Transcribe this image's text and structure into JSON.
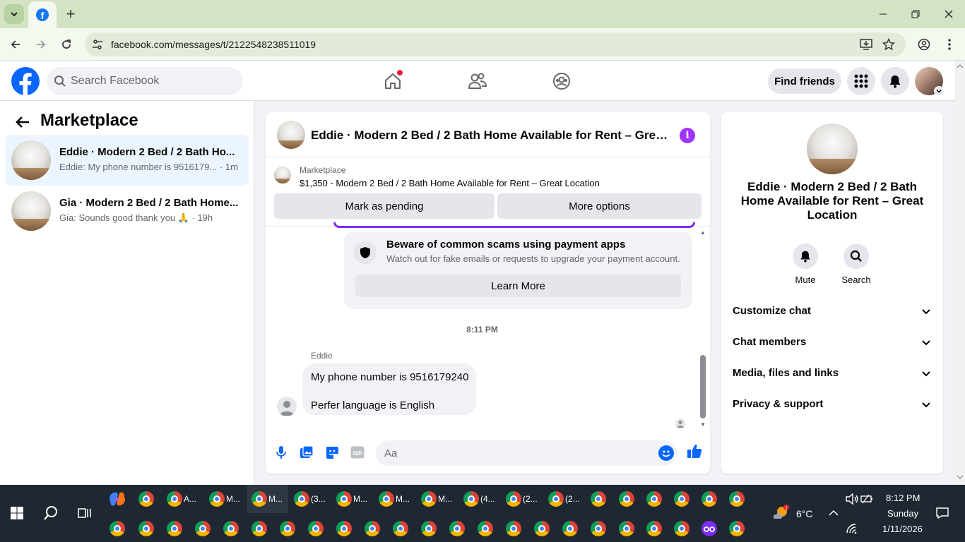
{
  "browser": {
    "url": "facebook.com/messages/t/2122548238511019"
  },
  "header": {
    "search_placeholder": "Search Facebook",
    "find_friends_label": "Find friends"
  },
  "left_panel": {
    "title": "Marketplace",
    "conversations": [
      {
        "title": "Eddie · Modern 2 Bed / 2 Bath Ho...",
        "preview": "Eddie: My phone number is 9516179...",
        "time": "· 1m",
        "active": true
      },
      {
        "title": "Gia · Modern 2 Bed / 2 Bath Home...",
        "preview": "Gia: Sounds good thank you 🙏",
        "time": "· 19h",
        "active": false
      }
    ]
  },
  "chat": {
    "title": "Eddie · Modern 2 Bed / 2 Bath Home Available for Rent – Great Location",
    "listing_source": "Marketplace",
    "listing_title": "$1,350 - Modern 2 Bed / 2 Bath Home Available for Rent – Great Location",
    "mark_pending_label": "Mark as pending",
    "more_options_label": "More options",
    "scam_notice_title": "Beware of common scams using payment apps",
    "scam_notice_text": "Watch out for fake emails or requests to upgrade your payment account.",
    "learn_more_label": "Learn More",
    "timestamp": "8:11 PM",
    "sender_name": "Eddie",
    "messages": [
      "My phone number is 9516179240",
      "Perfer language is English"
    ],
    "composer_placeholder": "Aa"
  },
  "right_panel": {
    "title": "Eddie · Modern 2 Bed / 2 Bath Home Available for Rent – Great Location",
    "mute_label": "Mute",
    "search_label": "Search",
    "sections": [
      "Customize chat",
      "Chat members",
      "Media, files and links",
      "Privacy & support"
    ]
  },
  "taskbar": {
    "app_labels": [
      "A...",
      "M...",
      "M...",
      "(3...",
      "M...",
      "M...",
      "M...",
      "(4...",
      "(2...",
      "(2..."
    ],
    "weather_temp": "6°C",
    "time": "8:12 PM",
    "day": "Sunday",
    "date": "1/11/2026"
  },
  "colors": {
    "facebook_blue": "#0866ff",
    "messenger_purple": "#a033ff",
    "active_conversation": "#ebf5ff",
    "browser_frame": "#d3e3c4"
  }
}
